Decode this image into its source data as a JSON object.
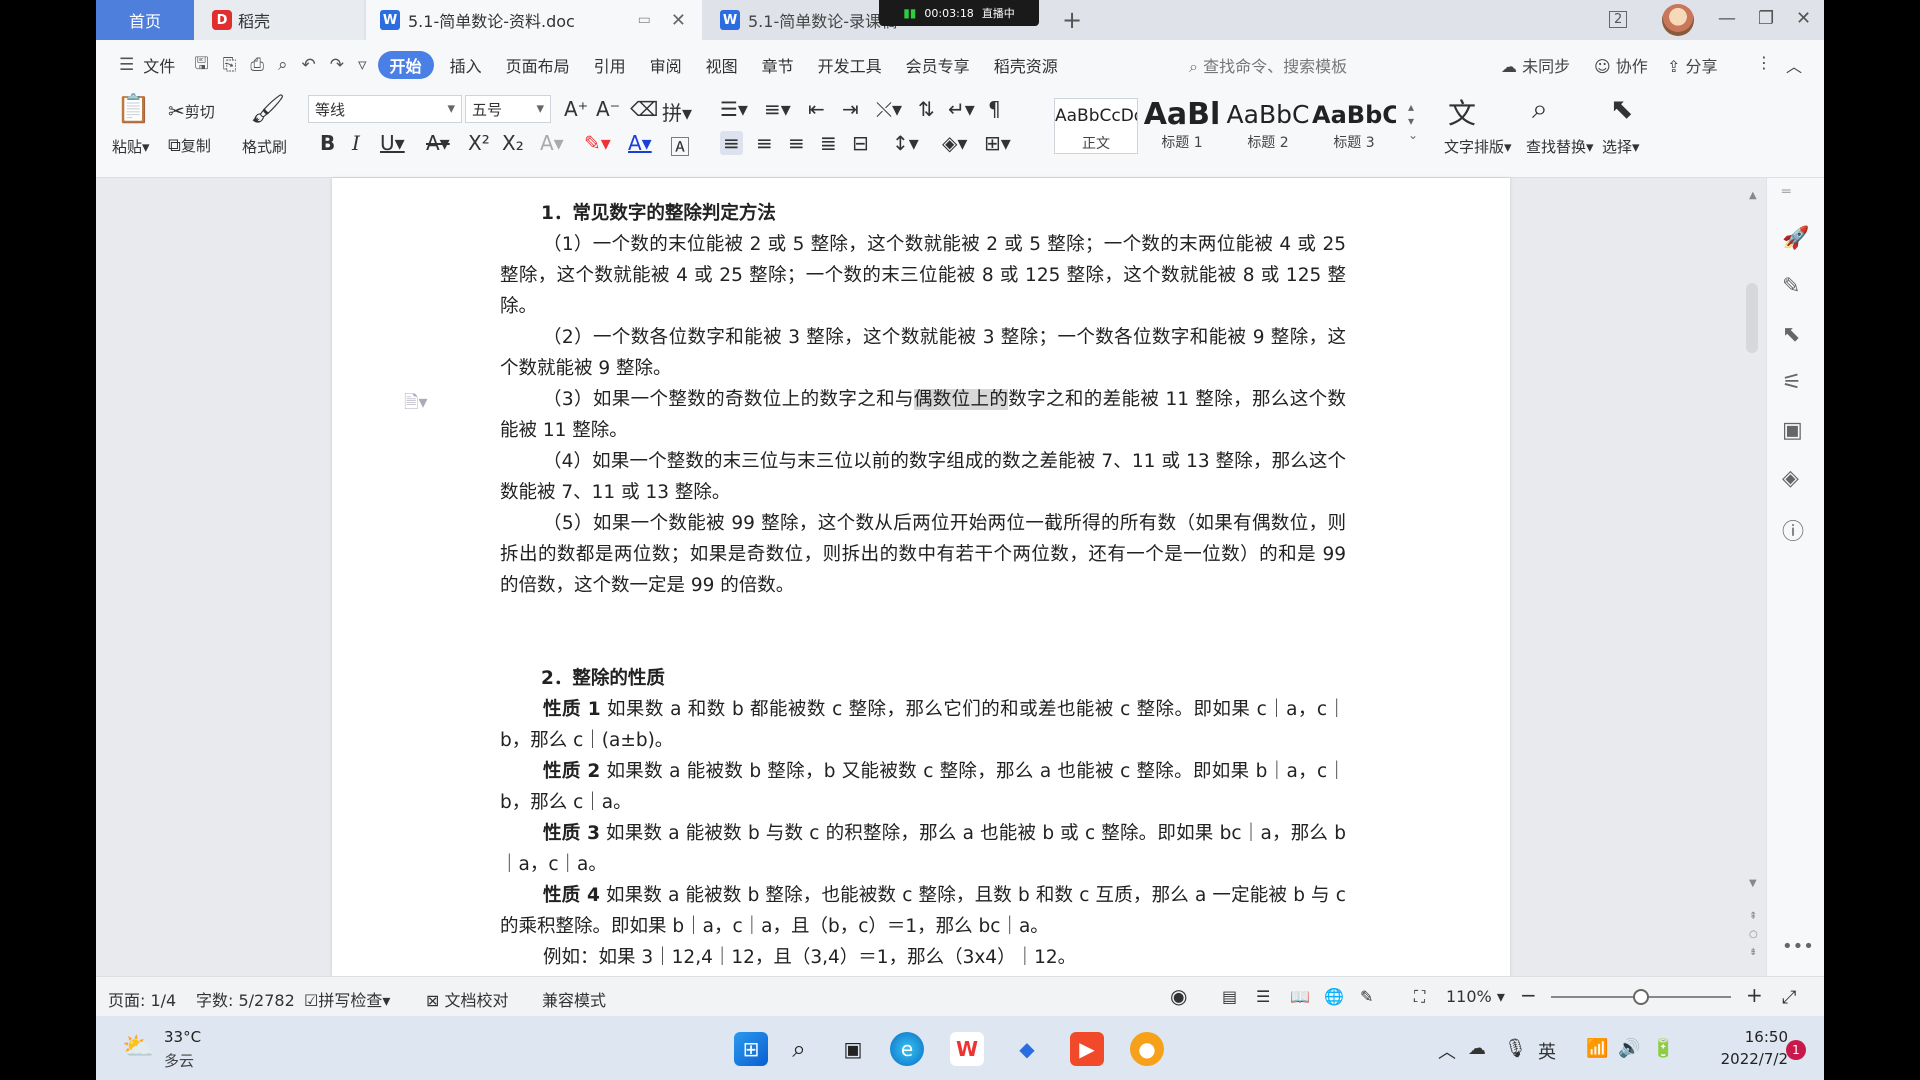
{
  "titlebar": {
    "tabs": [
      {
        "label": "首页"
      },
      {
        "label": "稻壳"
      },
      {
        "label": "5.1-简单数论-资料.doc"
      },
      {
        "label": "5.1-简单数论-录课稿"
      }
    ],
    "live_time": "00:03:18",
    "live_label": "直播中",
    "badge": "2"
  },
  "menu": {
    "file": "文件",
    "tabs": [
      "开始",
      "插入",
      "页面布局",
      "引用",
      "审阅",
      "视图",
      "章节",
      "开发工具",
      "会员专享",
      "稻壳资源"
    ],
    "search": "查找命令、搜索模板",
    "sync": "未同步",
    "collab": "协作",
    "share": "分享"
  },
  "ribbon": {
    "paste": "粘贴",
    "cut": "剪切",
    "copy": "复制",
    "format_painter": "格式刷",
    "font": "等线",
    "size": "五号",
    "styles": [
      {
        "preview": "AaBbCcDd",
        "name": "正文"
      },
      {
        "preview": "AaBl",
        "name": "标题 1"
      },
      {
        "preview": "AaBbC",
        "name": "标题 2"
      },
      {
        "preview": "AaBbC",
        "name": "标题 3"
      }
    ],
    "text_layout": "文字排版",
    "find_replace": "查找替换",
    "select": "选择"
  },
  "doc": {
    "h1": "1．常见数字的整除判定方法",
    "p1": "（1）一个数的末位能被 2 或 5 整除，这个数就能被 2 或 5 整除；一个数的末两位能被 4 或 25 整除，这个数就能被 4 或 25 整除；一个数的末三位能被 8 或 125 整除，这个数就能被 8 或 125 整除。",
    "p2": "（2）一个数各位数字和能被 3 整除，这个数就能被 3 整除；一个数各位数字和能被 9 整除，这个数就能被 9 整除。",
    "p3a": "（3）如果一个整数的奇数位上的数字之和与",
    "p3hl": "偶数位上的",
    "p3b": "数字之和的差能被 11 整除，那么这个数能被 11 整除。",
    "p4": "（4）如果一个整数的末三位与末三位以前的数字组成的数之差能被 7、11 或 13 整除，那么这个数能被 7、11 或 13 整除。",
    "p5": "（5）如果一个数能被 99 整除，这个数从后两位开始两位一截所得的所有数（如果有偶数位，则拆出的数都是两位数；如果是奇数位，则拆出的数中有若干个两位数，还有一个是一位数）的和是 99 的倍数，这个数一定是 99 的倍数。",
    "h2": "2．整除的性质",
    "props": [
      {
        "label": "性质 1",
        "text": " 如果数 a 和数 b 都能被数 c 整除，那么它们的和或差也能被 c 整除。即如果 c｜a，c｜b，那么 c｜(a±b)。"
      },
      {
        "label": "性质 2",
        "text": " 如果数 a 能被数 b 整除，b 又能被数 c 整除，那么 a 也能被 c 整除。即如果 b｜a，c｜b，那么 c｜a。"
      },
      {
        "label": "性质 3",
        "text": " 如果数 a 能被数 b 与数 c 的积整除，那么 a 也能被 b 或 c 整除。即如果 bc｜a，那么 b｜a，c｜a。"
      },
      {
        "label": "性质 4",
        "text": " 如果数 a 能被数 b 整除，也能被数 c 整除，且数 b 和数 c 互质，那么 a 一定能被 b 与 c 的乘积整除。即如果 b｜a，c｜a，且（b，c）＝1，那么 bc｜a。"
      }
    ],
    "example": "例如：如果 3｜12,4｜12，且（3,4）＝1，那么（3x4）｜12。"
  },
  "status": {
    "page": "页面: 1/4",
    "words": "字数: 5/2782",
    "spell": "拼写检查",
    "proof": "文档校对",
    "compat": "兼容模式",
    "zoom": "110%",
    "zoom_level": 0.5
  },
  "taskbar": {
    "temp": "33°C",
    "weather": "多云",
    "ime": "英",
    "time": "16:50",
    "date": "2022/7/2",
    "notif": "1"
  }
}
